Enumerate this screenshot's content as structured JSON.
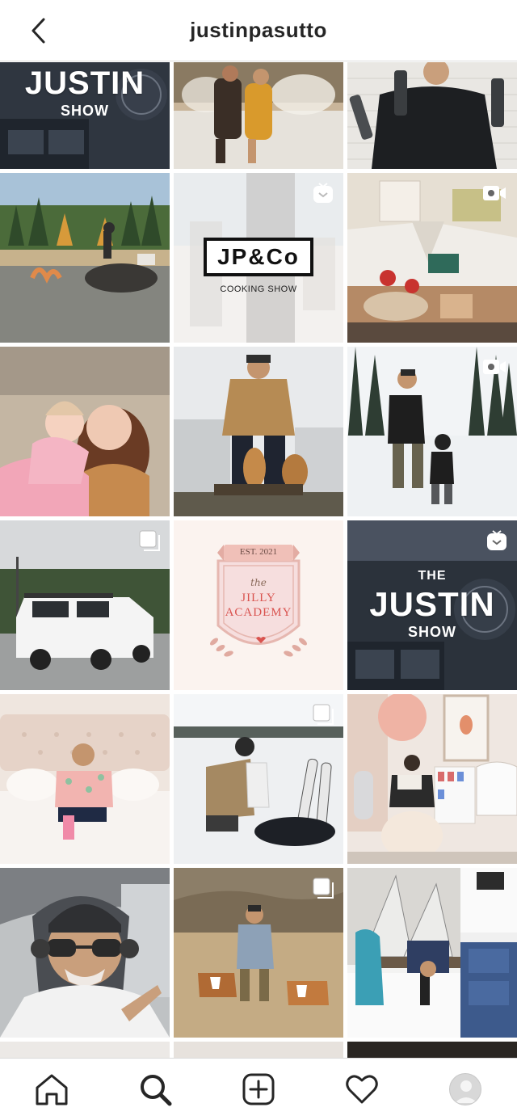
{
  "header": {
    "username": "justinpasutto",
    "back_icon": "chevron-left-icon"
  },
  "posts": [
    {
      "kind": "show-cover",
      "line1": "JUSTIN",
      "line2": "SHOW",
      "icon": null
    },
    {
      "kind": "photo",
      "scene": "couple-fountain",
      "icon": null
    },
    {
      "kind": "photo",
      "scene": "man-bottles",
      "icon": null
    },
    {
      "kind": "photo",
      "scene": "man-on-rock-lake",
      "icon": null
    },
    {
      "kind": "brand",
      "logo": "JP&Co",
      "subtitle": "COOKING SHOW",
      "icon": "igtv-icon"
    },
    {
      "kind": "photo",
      "scene": "kids-fort",
      "icon": "video-icon"
    },
    {
      "kind": "photo",
      "scene": "mother-daughter",
      "icon": null
    },
    {
      "kind": "photo",
      "scene": "man-two-dogs",
      "icon": null
    },
    {
      "kind": "photo",
      "scene": "snow-walk",
      "icon": "video-icon"
    },
    {
      "kind": "photo",
      "scene": "white-truck",
      "icon": "carousel-icon"
    },
    {
      "kind": "badge",
      "est": "EST. 2021",
      "the": "the",
      "line1": "JILLY",
      "line2": "ACADEMY",
      "icon": null
    },
    {
      "kind": "show-cover",
      "top": "THE",
      "line1": "JUSTIN",
      "line2": "SHOW",
      "icon": "igtv-icon"
    },
    {
      "kind": "photo",
      "scene": "man-on-bed",
      "icon": null
    },
    {
      "kind": "photo",
      "scene": "snow-gear",
      "icon": "carousel-icon"
    },
    {
      "kind": "photo",
      "scene": "nursery-reading",
      "icon": null
    },
    {
      "kind": "photo",
      "scene": "helicopter-selfie",
      "icon": null
    },
    {
      "kind": "photo",
      "scene": "dog-walk-field",
      "icon": "carousel-icon"
    },
    {
      "kind": "photo",
      "scene": "kids-room-book",
      "icon": null
    }
  ],
  "tabbar": {
    "items": [
      "home-icon",
      "search-icon",
      "new-post-icon",
      "activity-heart-icon",
      "profile-avatar"
    ]
  }
}
